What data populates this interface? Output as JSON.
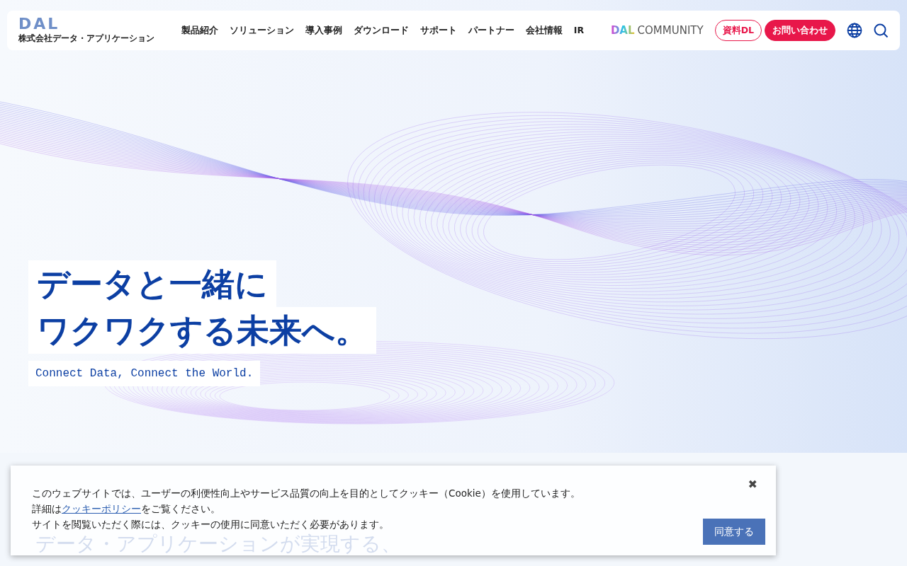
{
  "header": {
    "logo": {
      "mark": "DAL",
      "company": "株式会社データ・アプリケーション"
    },
    "nav": [
      "製品紹介",
      "ソリューション",
      "導入事例",
      "ダウンロード",
      "サポート",
      "パートナー",
      "会社情報",
      "IR"
    ],
    "community": {
      "mark": "DAL",
      "label": "COMMUNITY"
    },
    "buttons": [
      {
        "label": "資料DL",
        "kind": "outline"
      },
      {
        "label": "お問い合わせ",
        "kind": "solid"
      }
    ]
  },
  "hero": {
    "headline": [
      "データと一緒に",
      "ワクワクする未来へ。"
    ],
    "tagline": "Connect Data, Connect the World."
  },
  "section": {
    "heading": "データ・アプリケーションが実現する、"
  },
  "cookie_banner": {
    "lines": [
      {
        "text": "このウェブサイトでは、ユーザーの利便性向上やサービス品質の向上を目的としてクッキー（Cookie）を使用しています。"
      },
      {
        "text": "詳細は",
        "link": "クッキーポリシー",
        "after": "をご覧ください。"
      },
      {
        "text": "サイトを閲覧いただく際には、クッキーの使用に同意いただく必要があります。"
      }
    ],
    "close": "✖",
    "accept": "同意する"
  }
}
